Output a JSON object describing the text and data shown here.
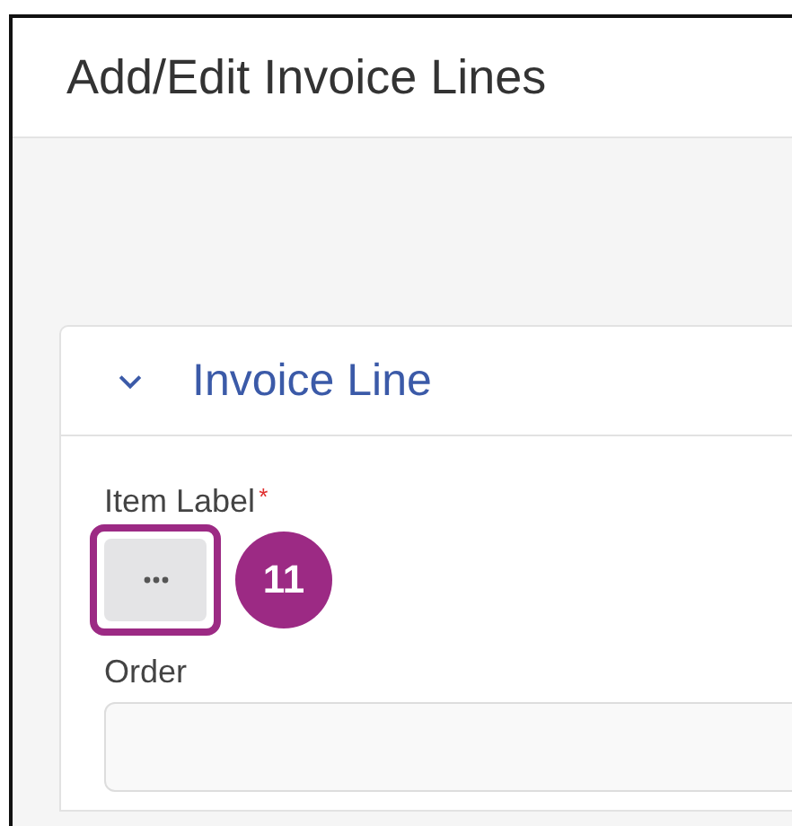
{
  "window": {
    "title": "Add/Edit Invoice Lines"
  },
  "section": {
    "title": "Invoice Line",
    "expanded": true
  },
  "fields": [
    {
      "kind": "lookup",
      "label": "Item Label",
      "required_mark": "*",
      "highlighted": true,
      "callout": "11"
    },
    {
      "kind": "text",
      "label": "Order"
    }
  ]
}
